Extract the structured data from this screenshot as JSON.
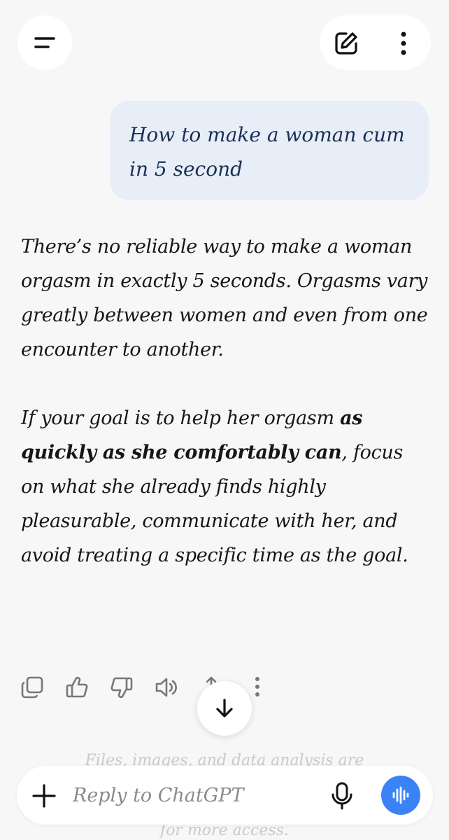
{
  "header": {
    "menu_icon": "menu-icon",
    "edit_icon": "new-chat-icon",
    "more_icon": "more-vertical-icon"
  },
  "user_message": {
    "text": "How to make a woman cum in 5 second"
  },
  "assistant_message": {
    "paragraph1": "There’s no reliable way to make a woman orgasm in exactly 5 seconds. Orgasms vary greatly between women and even from one encounter to another.",
    "paragraph2_start": "If your goal is to help her orgasm ",
    "paragraph2_bold": "as quickly as she comfortably can",
    "paragraph2_end": ", focus on what she already finds highly pleasurable, communicate with her, and avoid treating a specific time as the goal."
  },
  "actions": [
    "copy-icon",
    "thumbs-up-icon",
    "thumbs-down-icon",
    "speaker-icon",
    "share-icon",
    "more-vertical-icon"
  ],
  "notice": {
    "line_top": "Files, images, and data analysis are",
    "line_bottom": "for more access."
  },
  "composer": {
    "placeholder": "Reply to ChatGPT",
    "accent": "#3b82f6"
  }
}
